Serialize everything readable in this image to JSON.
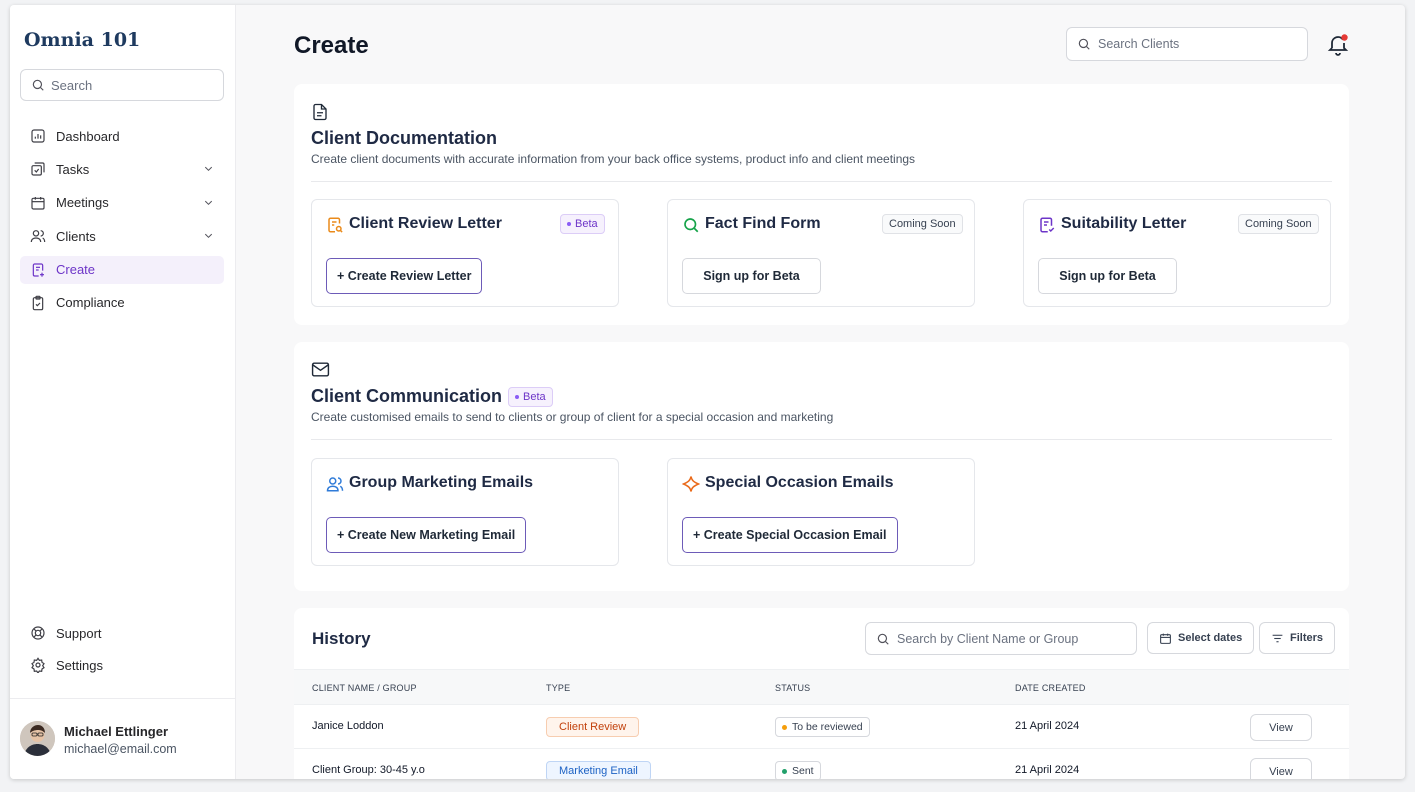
{
  "app": {
    "brand": "Omnia 101"
  },
  "sidebar": {
    "search_placeholder": "Search",
    "items": [
      {
        "label": "Dashboard",
        "icon": "chart-icon"
      },
      {
        "label": "Tasks",
        "icon": "tasks-icon",
        "expandable": true
      },
      {
        "label": "Meetings",
        "icon": "calendar-icon",
        "expandable": true
      },
      {
        "label": "Clients",
        "icon": "users-icon",
        "expandable": true
      },
      {
        "label": "Create",
        "icon": "create-doc-icon",
        "active": true
      },
      {
        "label": "Compliance",
        "icon": "clipboard-check-icon"
      }
    ],
    "bottom": [
      {
        "label": "Support",
        "icon": "lifebuoy-icon"
      },
      {
        "label": "Settings",
        "icon": "gear-icon"
      }
    ],
    "user": {
      "name": "Michael Ettlinger",
      "email": "michael@email.com"
    }
  },
  "header": {
    "title": "Create",
    "search_placeholder": "Search Clients"
  },
  "documentation": {
    "title": "Client Documentation",
    "description": "Create client documents with accurate information from your back office systems, product info and client meetings",
    "cards": [
      {
        "title": "Client Review Letter",
        "badge": "Beta",
        "action": "+ Create Review Letter"
      },
      {
        "title": "Fact Find Form",
        "badge": "Coming Soon",
        "action": "Sign up for Beta"
      },
      {
        "title": "Suitability Letter",
        "badge": "Coming Soon",
        "action": "Sign up for Beta"
      }
    ]
  },
  "communication": {
    "title": "Client Communication",
    "badge": "Beta",
    "description": "Create customised emails to send to clients or group of client for a special occasion and marketing",
    "cards": [
      {
        "title": "Group Marketing Emails",
        "action": "+ Create New Marketing Email"
      },
      {
        "title": "Special Occasion Emails",
        "action": "+ Create Special Occasion Email"
      }
    ]
  },
  "history": {
    "title": "History",
    "search_placeholder": "Search by Client Name or Group",
    "select_dates": "Select dates",
    "filters": "Filters",
    "columns": [
      "CLIENT NAME / GROUP",
      "TYPE",
      "STATUS",
      "DATE CREATED"
    ],
    "rows": [
      {
        "client": "Janice Loddon",
        "type": "Client Review",
        "status": "To be reviewed",
        "date": "21 April 2024",
        "action": "View"
      },
      {
        "client": "Client Group: 30-45 y.o",
        "type": "Marketing Email",
        "status": "Sent",
        "date": "21 April 2024",
        "action": "View"
      }
    ]
  },
  "colors": {
    "accent": "#6d35c8",
    "brand": "#1e3a5f",
    "notification_dot": "#e53935",
    "status_pending": "#f59e0b",
    "status_sent": "#22a06b"
  }
}
